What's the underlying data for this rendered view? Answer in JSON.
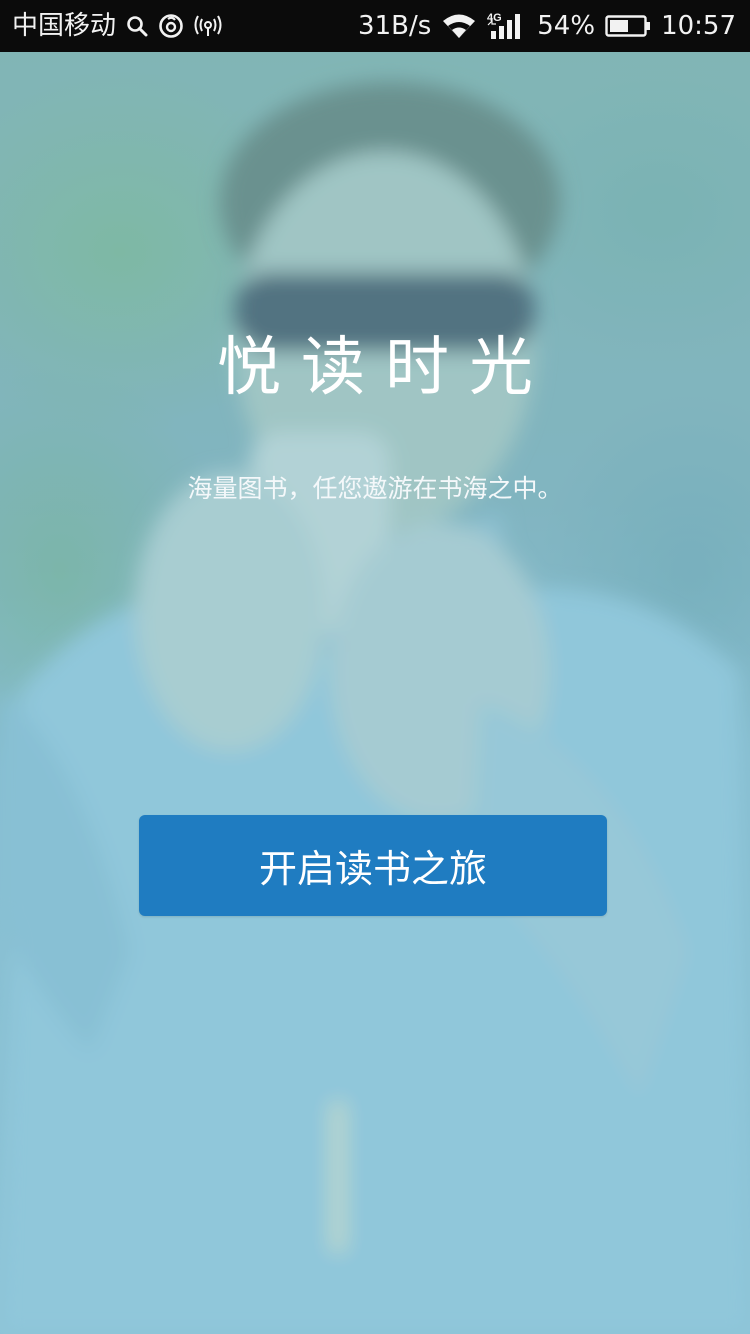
{
  "status_bar": {
    "carrier": "中国移动",
    "network_speed": "31B/s",
    "network_type": "4G",
    "battery": "54%",
    "time": "10:57",
    "icons": [
      "search-icon",
      "netease-icon",
      "hotspot-icon",
      "wifi-icon",
      "signal-icon",
      "battery-icon"
    ]
  },
  "main": {
    "title": "悦读时光",
    "subtitle": "海量图书，任您遨游在书海之中。",
    "start_button_label": "开启读书之旅"
  },
  "colors": {
    "status_bar_bg": "#0b0b0b",
    "button_bg": "#1f7cc1",
    "text": "#ffffff",
    "background_tint": "#8ec4d6"
  }
}
